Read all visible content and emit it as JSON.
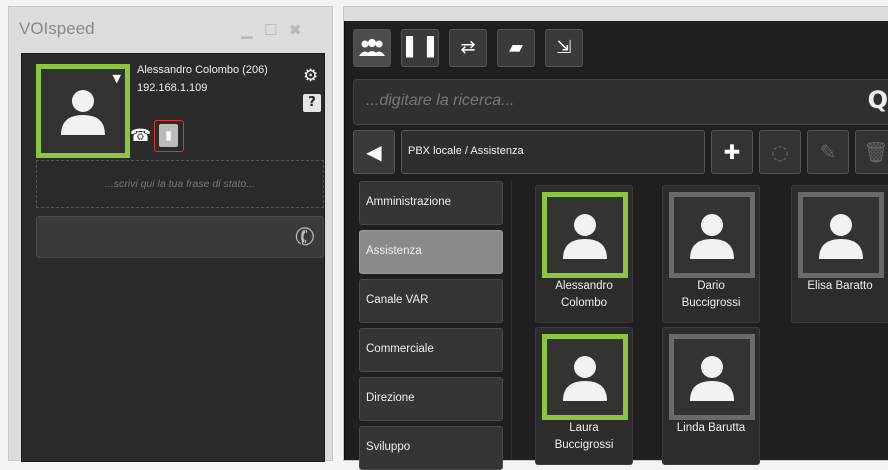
{
  "app": {
    "title": "VOIspeed"
  },
  "user": {
    "name": "Alessandro Colombo (206)",
    "ip": "192.168.1.109"
  },
  "status": {
    "placeholder": "...scrivi qui la tua frase di stato..."
  },
  "search": {
    "placeholder": "...digitare la ricerca..."
  },
  "breadcrumb": {
    "path": "PBX locale / Assistenza"
  },
  "groups": [
    {
      "label": "Amministrazione",
      "selected": false
    },
    {
      "label": "Assistenza",
      "selected": true
    },
    {
      "label": "Canale VAR",
      "selected": false
    },
    {
      "label": "Commerciale",
      "selected": false
    },
    {
      "label": "Direzione",
      "selected": false
    },
    {
      "label": "Sviluppo",
      "selected": false
    }
  ],
  "contacts": [
    {
      "line1": "Alessandro",
      "line2": "Colombo",
      "status": "online"
    },
    {
      "line1": "Dario",
      "line2": "Buccigrossi",
      "status": "offline"
    },
    {
      "line1": "Elisa Baratto",
      "line2": "",
      "status": "offline"
    },
    {
      "line1": "Laura",
      "line2": "Buccigrossi",
      "status": "online"
    },
    {
      "line1": "Linda Barutta",
      "line2": "",
      "status": "offline"
    }
  ],
  "colors": {
    "online": "#8cc63f",
    "offline": "#6a6a6a",
    "accent_red": "#dd3333"
  },
  "icons": {
    "toolbar": [
      "contacts-icon",
      "phonebook-icon",
      "transfer-icon",
      "chat-icon",
      "export-icon"
    ],
    "actions": [
      "add-icon",
      "conference-icon",
      "edit-icon",
      "delete-icon"
    ]
  }
}
